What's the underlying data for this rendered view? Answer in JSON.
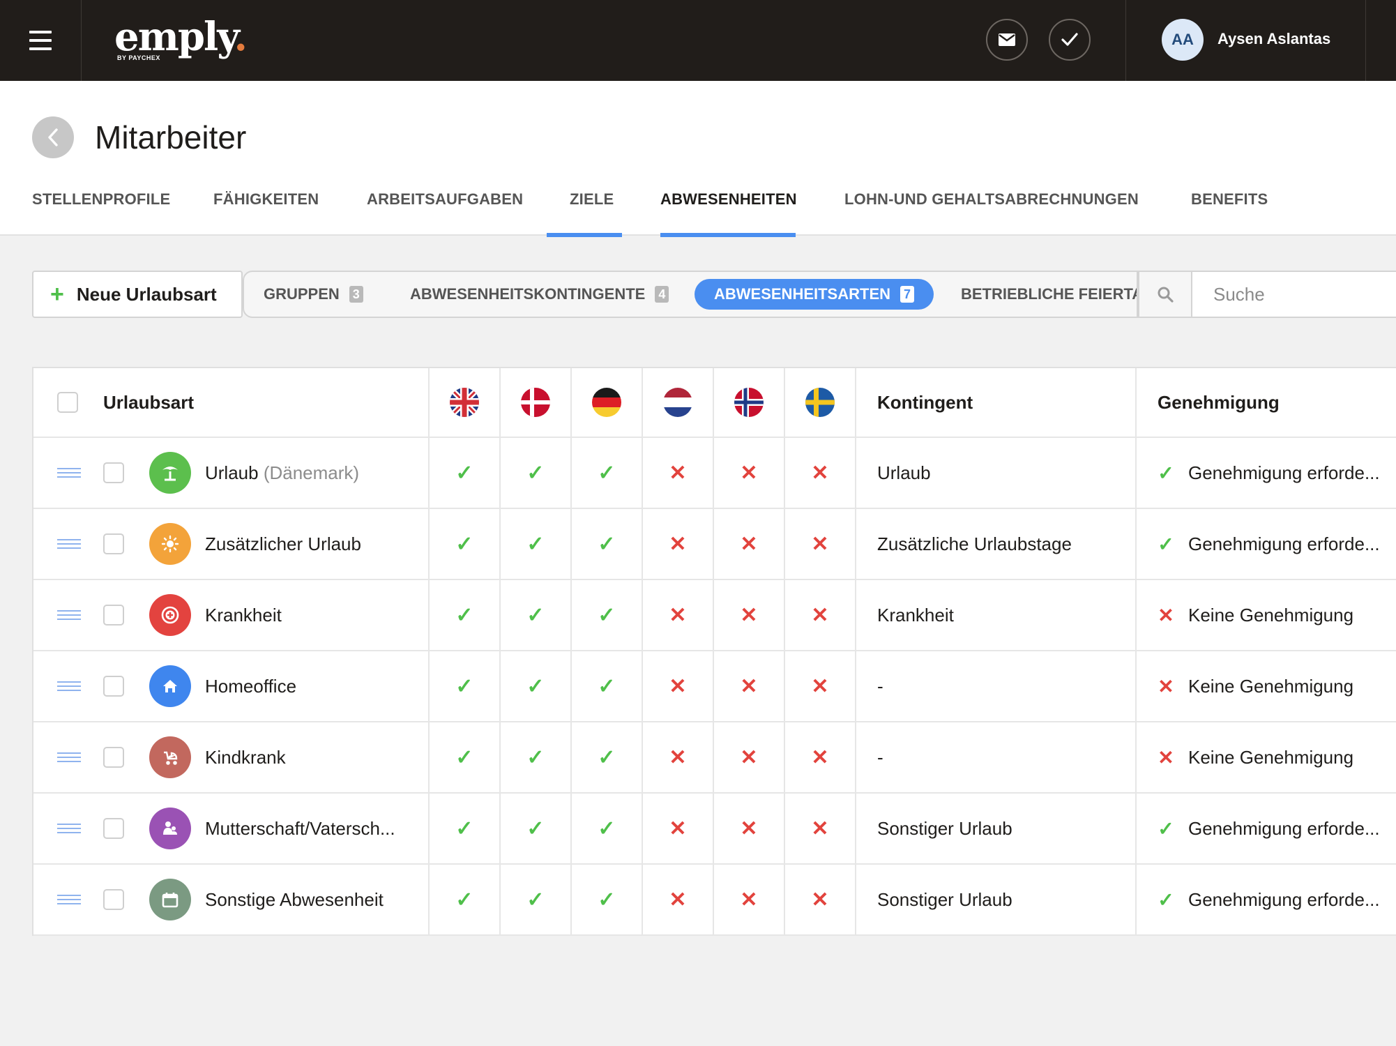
{
  "topbar": {
    "logo_text": "emply",
    "logo_dot": ".",
    "logo_sub": "BY PAYCHEX",
    "avatar_initials": "AA",
    "user_name": "Aysen Aslantas"
  },
  "page": {
    "title": "Mitarbeiter",
    "tabs": [
      {
        "label": "STELLENPROFILE"
      },
      {
        "label": "FÄHIGKEITEN"
      },
      {
        "label": "ARBEITSAUFGABEN"
      },
      {
        "label": "ZIELE"
      },
      {
        "label": "ABWESENHEITEN"
      },
      {
        "label": "LOHN-UND GEHALTSABRECHNUNGEN"
      },
      {
        "label": "BENEFITS"
      }
    ],
    "active_tab": "ABWESENHEITEN"
  },
  "toolbar": {
    "new_button": "Neue Urlaubsart",
    "filter_tabs": [
      {
        "label": "GRUPPEN",
        "count": "3"
      },
      {
        "label": "ABWESENHEITSKONTINGENTE",
        "count": "4"
      },
      {
        "label": "ABWESENHEITSARTEN",
        "count": "7"
      },
      {
        "label": "BETRIEBLICHE FEIERTA",
        "count": ""
      }
    ],
    "active_filter": "ABWESENHEITSARTEN",
    "search_placeholder": "Suche"
  },
  "table": {
    "headers": {
      "type": "Urlaubsart",
      "flags": [
        "uk-flag",
        "denmark-flag",
        "germany-flag",
        "netherlands-flag",
        "norway-flag",
        "sweden-flag"
      ],
      "contingent": "Kontingent",
      "approval": "Genehmigung"
    },
    "rows": [
      {
        "name": "Urlaub",
        "suffix": "(Dänemark)",
        "icon": "palm-tree-icon",
        "color": "#5cbf4d",
        "flags": [
          "✓",
          "✓",
          "✓",
          "✕",
          "✕",
          "✕"
        ],
        "contingent": "Urlaub",
        "approval_mark": "✓",
        "approval": "Genehmigung erforde..."
      },
      {
        "name": "Zusätzlicher Urlaub",
        "suffix": "",
        "icon": "sun-icon",
        "color": "#f3a33a",
        "flags": [
          "✓",
          "✓",
          "✓",
          "✕",
          "✕",
          "✕"
        ],
        "contingent": "Zusätzliche Urlaubstage",
        "approval_mark": "✓",
        "approval": "Genehmigung erforde..."
      },
      {
        "name": "Krankheit",
        "suffix": "",
        "icon": "medical-cross-icon",
        "color": "#e3433f",
        "flags": [
          "✓",
          "✓",
          "✓",
          "✕",
          "✕",
          "✕"
        ],
        "contingent": "Krankheit",
        "approval_mark": "✕",
        "approval": "Keine Genehmigung"
      },
      {
        "name": "Homeoffice",
        "suffix": "",
        "icon": "home-icon",
        "color": "#3f86ee",
        "flags": [
          "✓",
          "✓",
          "✓",
          "✕",
          "✕",
          "✕"
        ],
        "contingent": "-",
        "approval_mark": "✕",
        "approval": "Keine Genehmigung"
      },
      {
        "name": "Kindkrank",
        "suffix": "",
        "icon": "stroller-icon",
        "color": "#c2685e",
        "flags": [
          "✓",
          "✓",
          "✓",
          "✕",
          "✕",
          "✕"
        ],
        "contingent": "-",
        "approval_mark": "✕",
        "approval": "Keine Genehmigung"
      },
      {
        "name": "Mutterschaft/Vatersch...",
        "suffix": "",
        "icon": "parent-child-icon",
        "color": "#9a52b4",
        "flags": [
          "✓",
          "✓",
          "✓",
          "✕",
          "✕",
          "✕"
        ],
        "contingent": "Sonstiger Urlaub",
        "approval_mark": "✓",
        "approval": "Genehmigung erforde..."
      },
      {
        "name": "Sonstige Abwesenheit",
        "suffix": "",
        "icon": "calendar-icon",
        "color": "#7b9a82",
        "flags": [
          "✓",
          "✓",
          "✓",
          "✕",
          "✕",
          "✕"
        ],
        "contingent": "Sonstiger Urlaub",
        "approval_mark": "✓",
        "approval": "Genehmigung erforde..."
      }
    ]
  }
}
